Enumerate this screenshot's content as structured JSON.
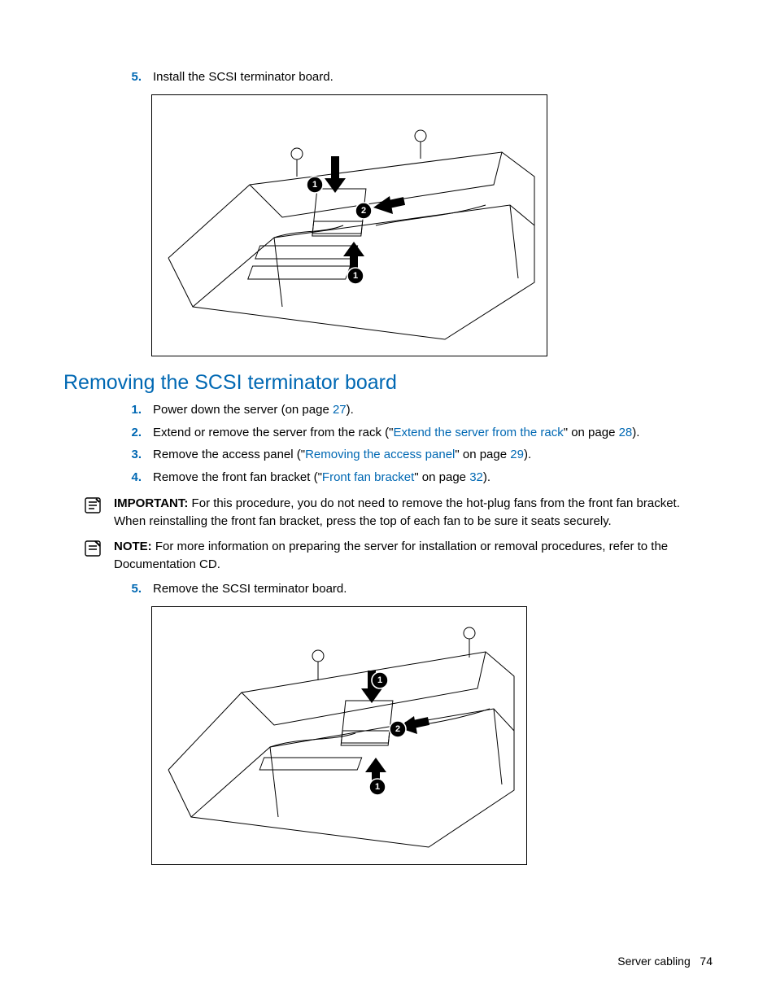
{
  "top_list": {
    "num": "5.",
    "text": "Install the SCSI terminator board."
  },
  "section_heading": "Removing the SCSI terminator board",
  "steps": [
    {
      "num": "1.",
      "pre": "Power down the server (on page ",
      "link": "",
      "page": "27",
      "post": ")."
    },
    {
      "num": "2.",
      "pre": "Extend or remove the server from the rack (\"",
      "link": "Extend the server from the rack",
      "mid": "\" on page ",
      "page": "28",
      "post": ")."
    },
    {
      "num": "3.",
      "pre": "Remove the access panel (\"",
      "link": "Removing the access panel",
      "mid": "\" on page ",
      "page": "29",
      "post": ")."
    },
    {
      "num": "4.",
      "pre": "Remove the front fan bracket (\"",
      "link": "Front fan bracket",
      "mid": "\" on page ",
      "page": "32",
      "post": ")."
    }
  ],
  "important": {
    "label": "IMPORTANT:",
    "text": " For this procedure, you do not need to remove the hot-plug fans from the front fan bracket. When reinstalling the front fan bracket, press the top of each fan to be sure it seats securely."
  },
  "note": {
    "label": "NOTE:",
    "text": " For more information on preparing the server for installation or removal procedures, refer to the Documentation CD."
  },
  "step5": {
    "num": "5.",
    "text": "Remove the SCSI terminator board."
  },
  "footer": {
    "label": "Server cabling",
    "page": "74"
  },
  "fig_markers": {
    "m1": "1",
    "m2": "2"
  }
}
